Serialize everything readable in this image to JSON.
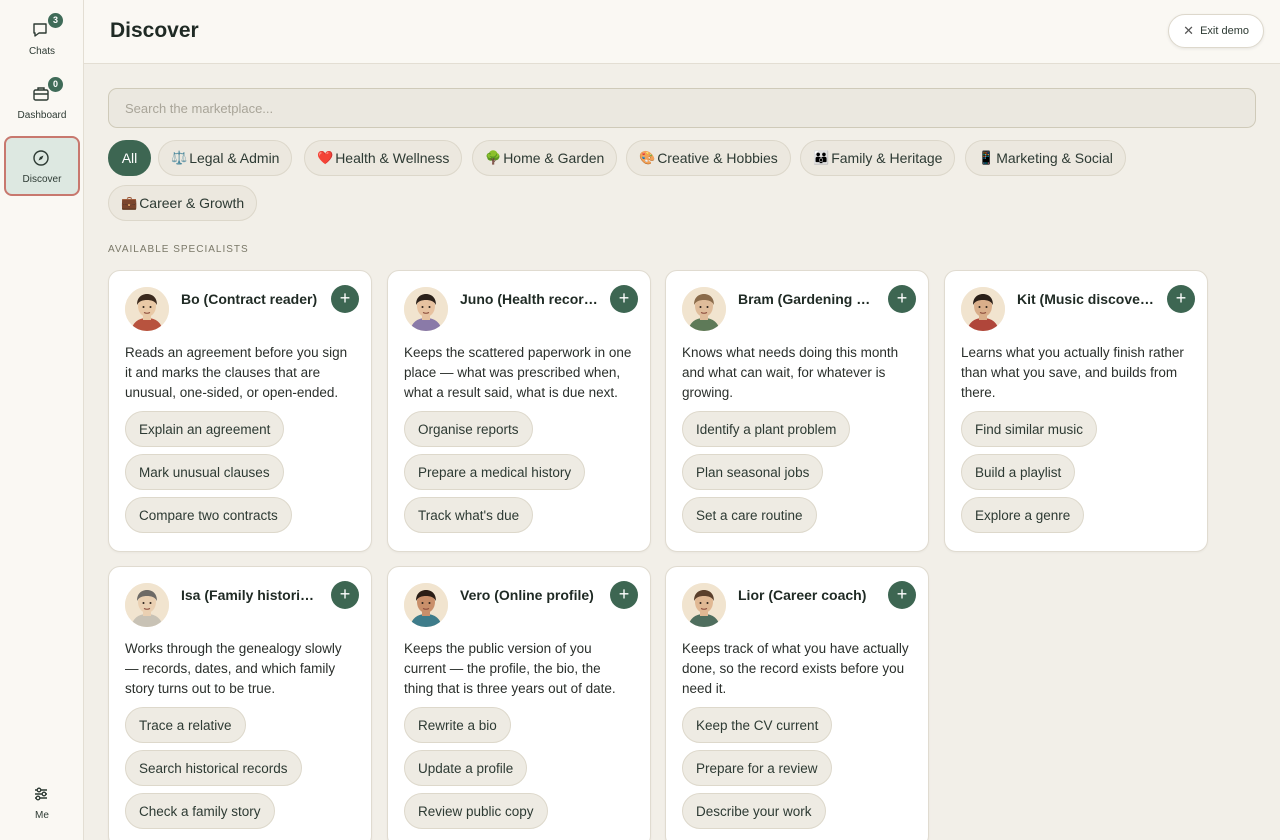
{
  "sidebar": {
    "items": [
      {
        "label": "Chats",
        "badge": "3",
        "icon": "chat-bubble-icon"
      },
      {
        "label": "Dashboard",
        "badge": "0",
        "icon": "briefcase-icon"
      },
      {
        "label": "Discover",
        "icon": "compass-icon"
      }
    ],
    "me": {
      "label": "Me",
      "icon": "sliders-icon"
    }
  },
  "header": {
    "title": "Discover",
    "exit_label": "Exit demo"
  },
  "search": {
    "placeholder": "Search the marketplace..."
  },
  "categories": [
    {
      "label": "All",
      "emoji": ""
    },
    {
      "label": "Legal & Admin",
      "emoji": "⚖️"
    },
    {
      "label": "Health & Wellness",
      "emoji": "❤️"
    },
    {
      "label": "Home & Garden",
      "emoji": "🌳"
    },
    {
      "label": "Creative & Hobbies",
      "emoji": "🎨"
    },
    {
      "label": "Family & Heritage",
      "emoji": "👪"
    },
    {
      "label": "Marketing & Social",
      "emoji": "📱"
    },
    {
      "label": "Career & Growth",
      "emoji": "💼"
    }
  ],
  "section_label": "AVAILABLE SPECIALISTS",
  "specialists": [
    {
      "name": "Bo (Contract reader)",
      "desc": "Reads an agreement before you sign it and marks the clauses that are unusual, one-sided, or open-ended.",
      "actions": [
        "Explain an agreement",
        "Mark unusual clauses",
        "Compare two contracts"
      ]
    },
    {
      "name": "Juno (Health records)",
      "desc": "Keeps the scattered paperwork in one place — what was prescribed when, what a result said, what is due next.",
      "actions": [
        "Organise reports",
        "Prepare a medical history",
        "Track what's due"
      ]
    },
    {
      "name": "Bram (Gardening helper)",
      "desc": "Knows what needs doing this month and what can wait, for whatever is growing.",
      "actions": [
        "Identify a plant problem",
        "Plan seasonal jobs",
        "Set a care routine"
      ]
    },
    {
      "name": "Kit (Music discovery)",
      "desc": "Learns what you actually finish rather than what you save, and builds from there.",
      "actions": [
        "Find similar music",
        "Build a playlist",
        "Explore a genre"
      ]
    },
    {
      "name": "Isa (Family historian)",
      "desc": "Works through the genealogy slowly — records, dates, and which family story turns out to be true.",
      "actions": [
        "Trace a relative",
        "Search historical records",
        "Check a family story"
      ]
    },
    {
      "name": "Vero (Online profile)",
      "desc": "Keeps the public version of you current — the profile, the bio, the thing that is three years out of date.",
      "actions": [
        "Rewrite a bio",
        "Update a profile",
        "Review public copy"
      ]
    },
    {
      "name": "Lior (Career coach)",
      "desc": "Keeps track of what you have actually done, so the record exists before you need it.",
      "actions": [
        "Keep the CV current",
        "Prepare for a review",
        "Describe your work"
      ]
    }
  ]
}
